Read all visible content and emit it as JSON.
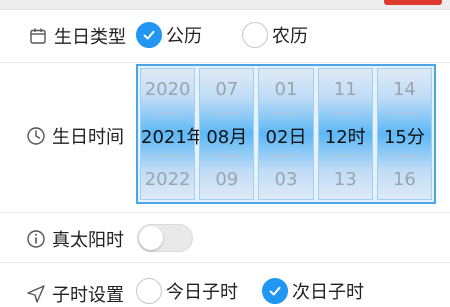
{
  "birthday_type": {
    "label": "生日类型",
    "icon": "calendar-icon",
    "options": [
      {
        "label": "公历",
        "checked": true
      },
      {
        "label": "农历",
        "checked": false
      }
    ]
  },
  "birthday_time": {
    "label": "生日时间",
    "icon": "clock-icon",
    "columns": [
      {
        "prev": "2020",
        "selected": "2021年",
        "next": "2022"
      },
      {
        "prev": "07",
        "selected": "08月",
        "next": "09"
      },
      {
        "prev": "01",
        "selected": "02日",
        "next": "03"
      },
      {
        "prev": "11",
        "selected": "12时",
        "next": "13"
      },
      {
        "prev": "14",
        "selected": "15分",
        "next": "16"
      }
    ]
  },
  "true_solar_time": {
    "label": "真太阳时",
    "icon": "info-icon",
    "enabled": false
  },
  "zi_hour_setting": {
    "label": "子时设置",
    "icon": "send-icon",
    "options": [
      {
        "label": "今日子时",
        "checked": false
      },
      {
        "label": "次日子时",
        "checked": true
      }
    ]
  },
  "colors": {
    "accent": "#2196f3",
    "picker_border": "#4aa6e8",
    "top_stub": "#e03a2f"
  }
}
